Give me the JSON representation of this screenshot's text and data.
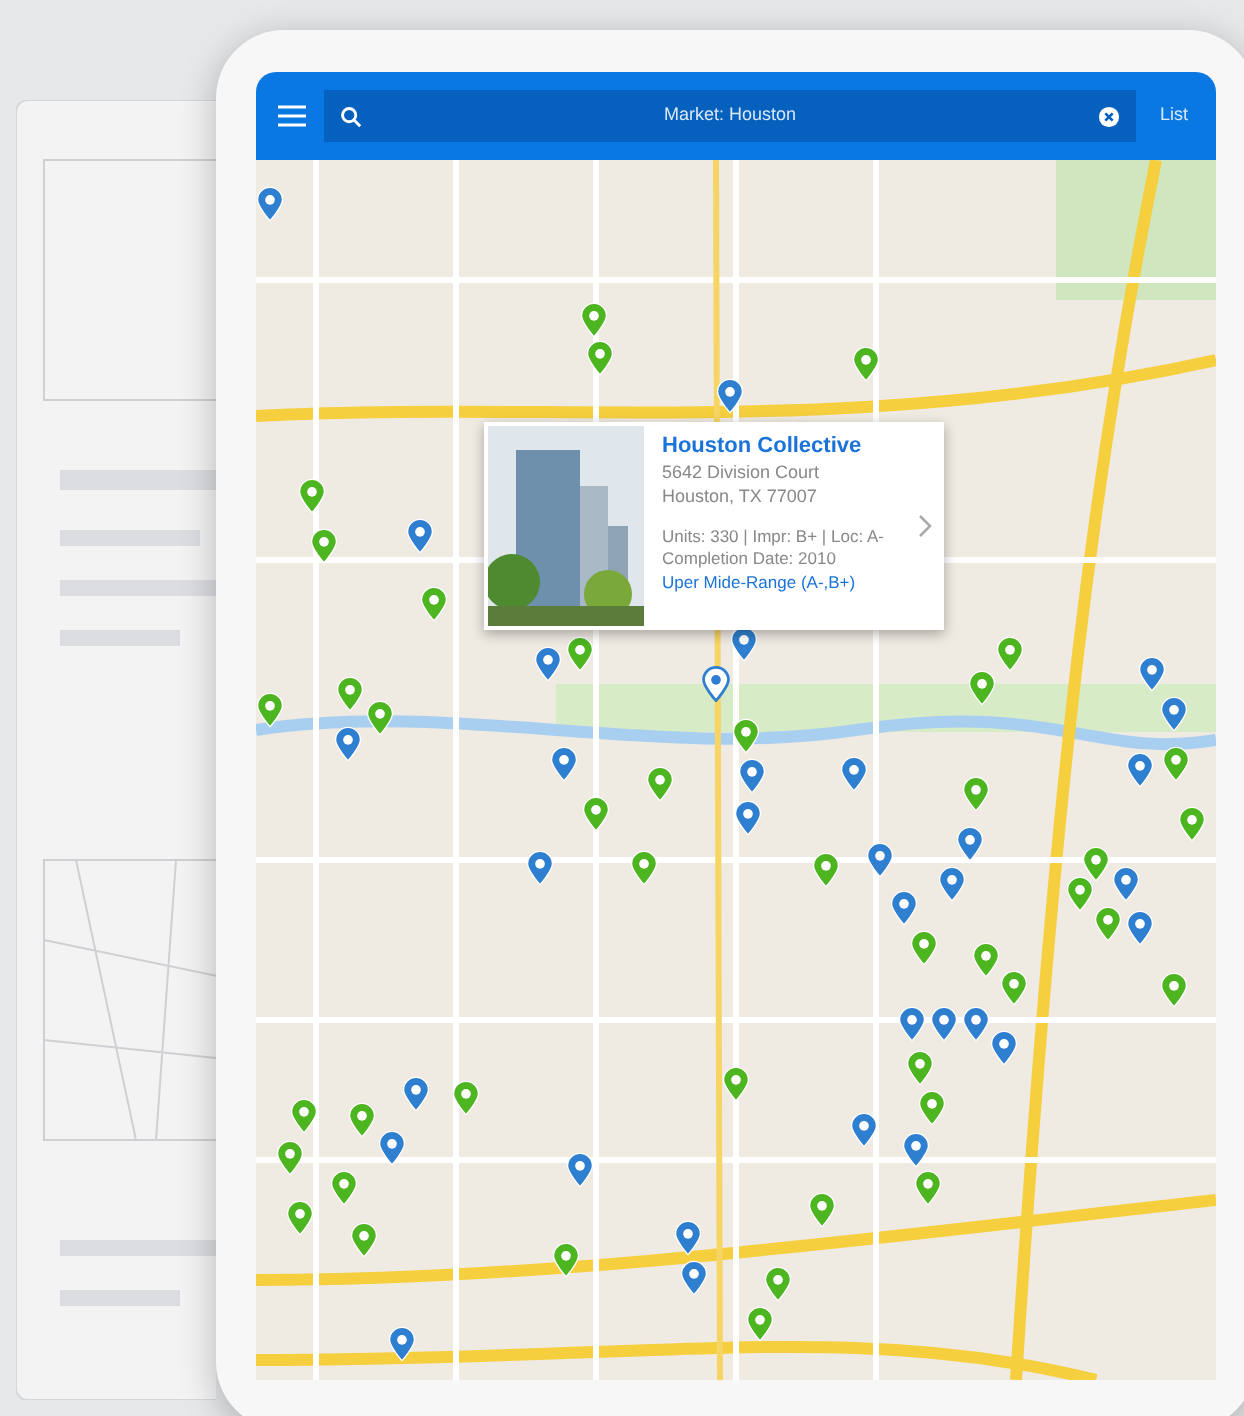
{
  "header": {
    "search": {
      "value": "Market: Houston"
    },
    "list_link": "List"
  },
  "popup": {
    "title": "Houston Collective",
    "address": [
      "5642 Division Court",
      "Houston, TX 77007"
    ],
    "details": [
      "Units: 330 | Impr: B+ | Loc: A-",
      "Completion Date: 2010"
    ],
    "range": "Uper Mide-Range (A-,B+)"
  },
  "pins": [
    {
      "color": "#4cb51f",
      "selected": false
    },
    {
      "color": "#4cb51f",
      "selected": false
    },
    {
      "color": "#4cb51f",
      "selected": false
    },
    {
      "color": "#4cb51f",
      "selected": false
    },
    {
      "color": "#4cb51f",
      "selected": false
    },
    {
      "color": "#4cb51f",
      "selected": false
    },
    {
      "color": "#4cb51f",
      "selected": false
    },
    {
      "color": "#4cb51f",
      "selected": false
    },
    {
      "color": "#4cb51f",
      "selected": false
    },
    {
      "color": "#4cb51f",
      "selected": false
    },
    {
      "color": "#4cb51f",
      "selected": false
    },
    {
      "color": "#4cb51f",
      "selected": false
    },
    {
      "color": "#4cb51f",
      "selected": false
    },
    {
      "color": "#4cb51f",
      "selected": false
    },
    {
      "color": "#4cb51f",
      "selected": false
    },
    {
      "color": "#4cb51f",
      "selected": false
    },
    {
      "color": "#4cb51f",
      "selected": false
    },
    {
      "color": "#4cb51f",
      "selected": false
    },
    {
      "color": "#4cb51f",
      "selected": false
    },
    {
      "color": "#4cb51f",
      "selected": false
    },
    {
      "color": "#4cb51f",
      "selected": false
    },
    {
      "color": "#4cb51f",
      "selected": false
    },
    {
      "color": "#4cb51f",
      "selected": false
    },
    {
      "color": "#4cb51f",
      "selected": false
    },
    {
      "color": "#4cb51f",
      "selected": false
    },
    {
      "color": "#4cb51f",
      "selected": false
    },
    {
      "color": "#4cb51f",
      "selected": false
    },
    {
      "color": "#4cb51f",
      "selected": false
    },
    {
      "color": "#4cb51f",
      "selected": false
    },
    {
      "color": "#4cb51f",
      "selected": false
    },
    {
      "color": "#4cb51f",
      "selected": false
    },
    {
      "color": "#4cb51f",
      "selected": false
    },
    {
      "color": "#4cb51f",
      "selected": false
    },
    {
      "color": "#4cb51f",
      "selected": false
    },
    {
      "color": "#4cb51f",
      "selected": false
    },
    {
      "color": "#4cb51f",
      "selected": false
    },
    {
      "color": "#4cb51f",
      "selected": false
    },
    {
      "color": "#4cb51f",
      "selected": false
    },
    {
      "color": "#4cb51f",
      "selected": false
    },
    {
      "color": "#4cb51f",
      "selected": false
    },
    {
      "color": "#4cb51f",
      "selected": false
    },
    {
      "color": "#4cb51f",
      "selected": false
    },
    {
      "color": "#2f7fd0",
      "selected": false
    },
    {
      "color": "#2f7fd0",
      "selected": false
    },
    {
      "color": "#2f7fd0",
      "selected": false
    },
    {
      "color": "#2f7fd0",
      "selected": false
    },
    {
      "color": "#2f7fd0",
      "selected": false
    },
    {
      "color": "#2f7fd0",
      "selected": false
    },
    {
      "color": "#2f7fd0",
      "selected": false
    },
    {
      "color": "#2f7fd0",
      "selected": false
    },
    {
      "color": "#2f7fd0",
      "selected": false
    },
    {
      "color": "#2f7fd0",
      "selected": false
    },
    {
      "color": "#2f7fd0",
      "selected": false
    },
    {
      "color": "#2f7fd0",
      "selected": false
    },
    {
      "color": "#2f7fd0",
      "selected": false
    },
    {
      "color": "#2f7fd0",
      "selected": false
    },
    {
      "color": "#2f7fd0",
      "selected": false
    },
    {
      "color": "#2f7fd0",
      "selected": false
    },
    {
      "color": "#2f7fd0",
      "selected": false
    },
    {
      "color": "#2f7fd0",
      "selected": false
    },
    {
      "color": "#2f7fd0",
      "selected": false
    },
    {
      "color": "#2f7fd0",
      "selected": false
    },
    {
      "color": "#2f7fd0",
      "selected": false
    },
    {
      "color": "#2f7fd0",
      "selected": false
    },
    {
      "color": "#2f7fd0",
      "selected": false
    },
    {
      "color": "#2f7fd0",
      "selected": false
    },
    {
      "color": "#2f7fd0",
      "selected": false
    },
    {
      "color": "#2f7fd0",
      "selected": false
    },
    {
      "color": "#2f7fd0",
      "selected": false
    },
    {
      "color": "#2f7fd0",
      "selected": false
    },
    {
      "color": "#2f7fd0",
      "selected": false
    },
    {
      "color": "#2f7fd0",
      "selected": false
    },
    {
      "color": "#2f7fd0",
      "selected": false
    },
    {
      "color": "#2f7fd0",
      "selected": false
    },
    {
      "color": "#2f7fd0",
      "selected": true
    }
  ]
}
